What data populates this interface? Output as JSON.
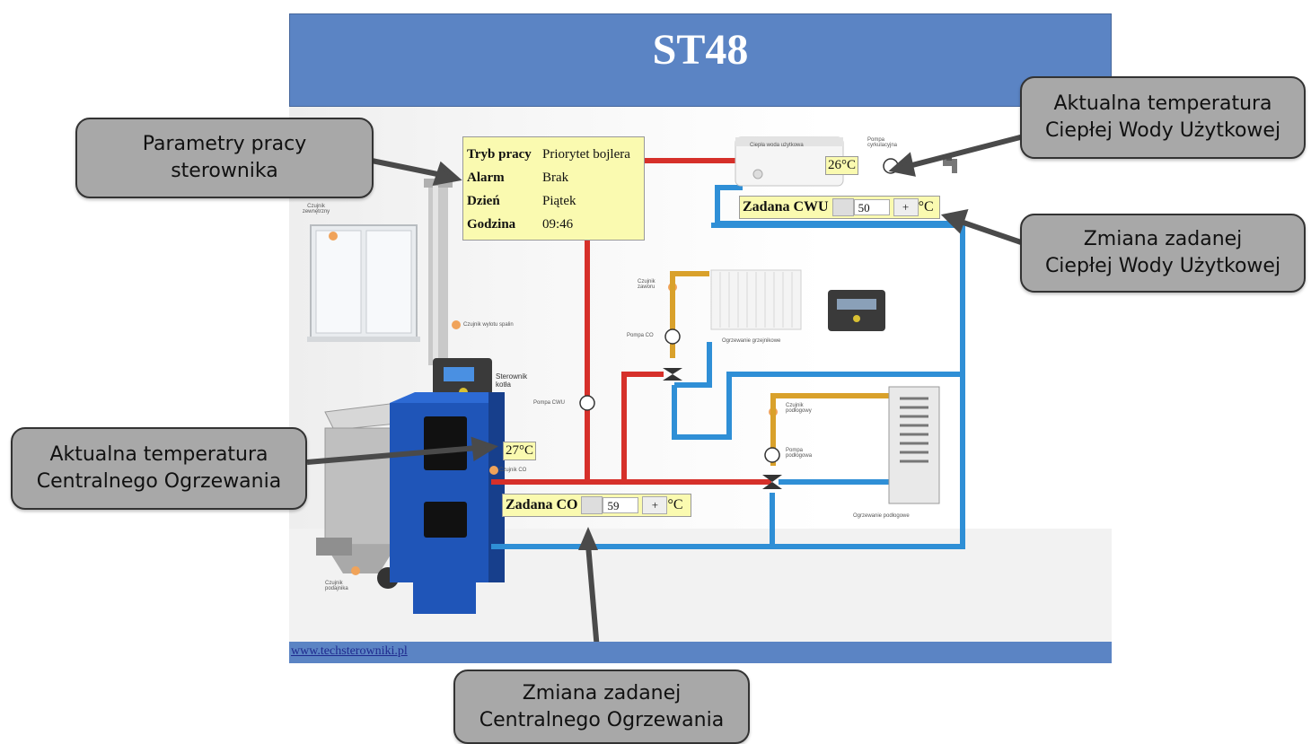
{
  "header": {
    "title": "ST48"
  },
  "footer": {
    "link": "www.techsterowniki.pl"
  },
  "params": {
    "rows": [
      {
        "key": "Tryb pracy",
        "value": "Priorytet bojlera"
      },
      {
        "key": "Alarm",
        "value": "Brak"
      },
      {
        "key": "Dzień",
        "value": "Piątek"
      },
      {
        "key": "Godzina",
        "value": "09:46"
      }
    ]
  },
  "cwu": {
    "temp": "26°C",
    "label": "Zadana CWU",
    "value": "50",
    "plus": "+",
    "unit": "°C"
  },
  "co": {
    "temp": "27°C",
    "label": "Zadana CO",
    "value": "59",
    "plus": "+",
    "unit": "°C"
  },
  "scene": {
    "czujnik_zewnetrzny": "Czujnik zewnętrzny",
    "czujnik_wylotu": "Czujnik wylotu spalin",
    "sterownik_kotla": "Sterownik kotła",
    "pompa_cwu": "Pompa CWU",
    "czujnik_co": "Czujnik CO",
    "czujnik_podajnika": "Czujnik podajnika",
    "czujnik_zaworu": "Czujnik zaworu",
    "pompa_co": "Pompa CO",
    "ogrzewanie_grzejnikowe": "Ogrzewanie grzejnikowe",
    "czujnik_podlogowy": "Czujnik podłogowy",
    "pompa_podlogowa": "Pompa podłogowa",
    "ogrzewanie_podlogowe": "Ogrzewanie podłogowe",
    "ciepla_woda": "Ciepła woda użytkowa",
    "pompa_cyrkulacyjna": "Pompa cyrkulacyjna"
  },
  "callouts": {
    "params": "Parametry pracy\nsterownika",
    "cwu_temp": "Aktualna temperatura\nCiepłej Wody Użytkowej",
    "cwu_set": "Zmiana zadanej\nCiepłej Wody Użytkowej",
    "co_temp": "Aktualna temperatura\nCentralnego Ogrzewania",
    "co_set": "Zmiana zadanej\nCentralnego Ogrzewania"
  },
  "colors": {
    "hot_pipe": "#d6302a",
    "cold_pipe": "#2f8fd6",
    "mix_pipe": "#d9a12b",
    "header": "#5b84c4",
    "boiler": "#1f55b8"
  }
}
